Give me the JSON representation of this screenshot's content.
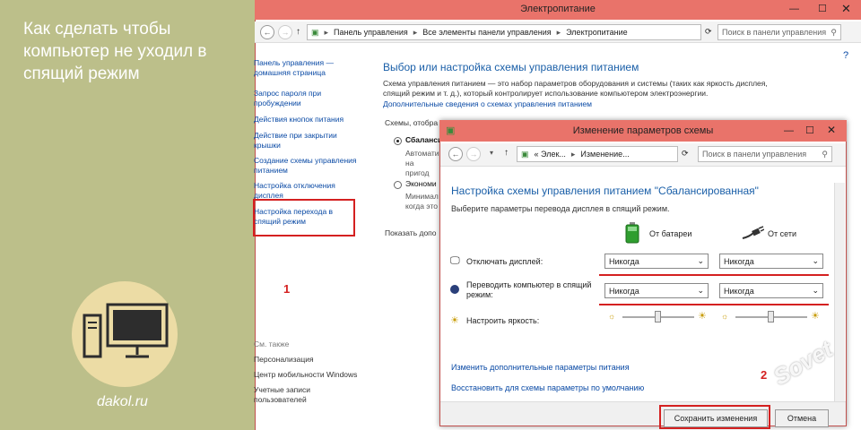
{
  "article": {
    "title": "Как сделать чтобы компьютер не уходил в спящий режим",
    "site": "dakol.ru",
    "watermark": "Sovet"
  },
  "back_window": {
    "title": "Электропитание",
    "breadcrumb": [
      "Панель управления",
      "Все элементы панели управления",
      "Электропитание"
    ],
    "search_placeholder": "Поиск в панели управления",
    "sidebar": {
      "home": "Панель управления — домашняя страница",
      "items": [
        "Запрос пароля при пробуждении",
        "Действия кнопок питания",
        "Действие при закрытии крышки",
        "Создание схемы управления питанием",
        "Настройка отключения дисплея",
        "Настройка перехода в спящий режим"
      ],
      "see_also_heading": "См. также",
      "see_also": [
        "Персонализация",
        "Центр мобильности Windows",
        "Учетные записи пользователей"
      ]
    },
    "heading": "Выбор или настройка схемы управления питанием",
    "description": "Схема управления питанием — это набор параметров оборудования и системы (таких как яркость дисплея, спящий режим и т. д.), который контролирует использование компьютером электроэнергии.",
    "more_link": "Дополнительные сведения о схемах управления питанием",
    "schemes_label": "Схемы, отобра",
    "scheme1_name": "Сбаланси",
    "scheme1_desc": "Автомати на пригод",
    "scheme2_name": "Экономи",
    "scheme2_desc": "Минимал когда это",
    "show_more": "Показать допо"
  },
  "dialog": {
    "title": "Изменение параметров схемы",
    "breadcrumb": [
      "« Элек...",
      "Изменение..."
    ],
    "search_placeholder": "Поиск в панели управления",
    "heading": "Настройка схемы управления питанием \"Сбалансированная\"",
    "subtitle": "Выберите параметры перевода дисплея в спящий режим.",
    "col_battery": "От батареи",
    "col_ac": "От сети",
    "row_display": "Отключать дисплей:",
    "row_sleep": "Переводить компьютер в спящий режим:",
    "row_brightness": "Настроить яркость:",
    "display_battery": "Никогда",
    "display_ac": "Никогда",
    "sleep_battery": "Никогда",
    "sleep_ac": "Никогда",
    "link_advanced": "Изменить дополнительные параметры питания",
    "link_restore": "Восстановить для схемы параметры по умолчанию",
    "save": "Сохранить изменения",
    "cancel": "Отмена"
  },
  "markers": {
    "m1": "1",
    "m2": "2"
  },
  "icons": [
    "back-arrow-icon",
    "forward-arrow-icon",
    "up-arrow-icon",
    "refresh-icon",
    "search-icon",
    "minimize-icon",
    "maximize-icon",
    "close-icon",
    "battery-icon",
    "plug-icon",
    "display-icon",
    "moon-icon",
    "sun-icon",
    "chevron-down-icon",
    "computer-illustration-icon",
    "control-panel-icon"
  ],
  "colors": {
    "accent_link": "#0a4aa5",
    "titlebar": "#e9736a",
    "highlight": "#d42020",
    "left_panel": "#bcbf8a"
  }
}
